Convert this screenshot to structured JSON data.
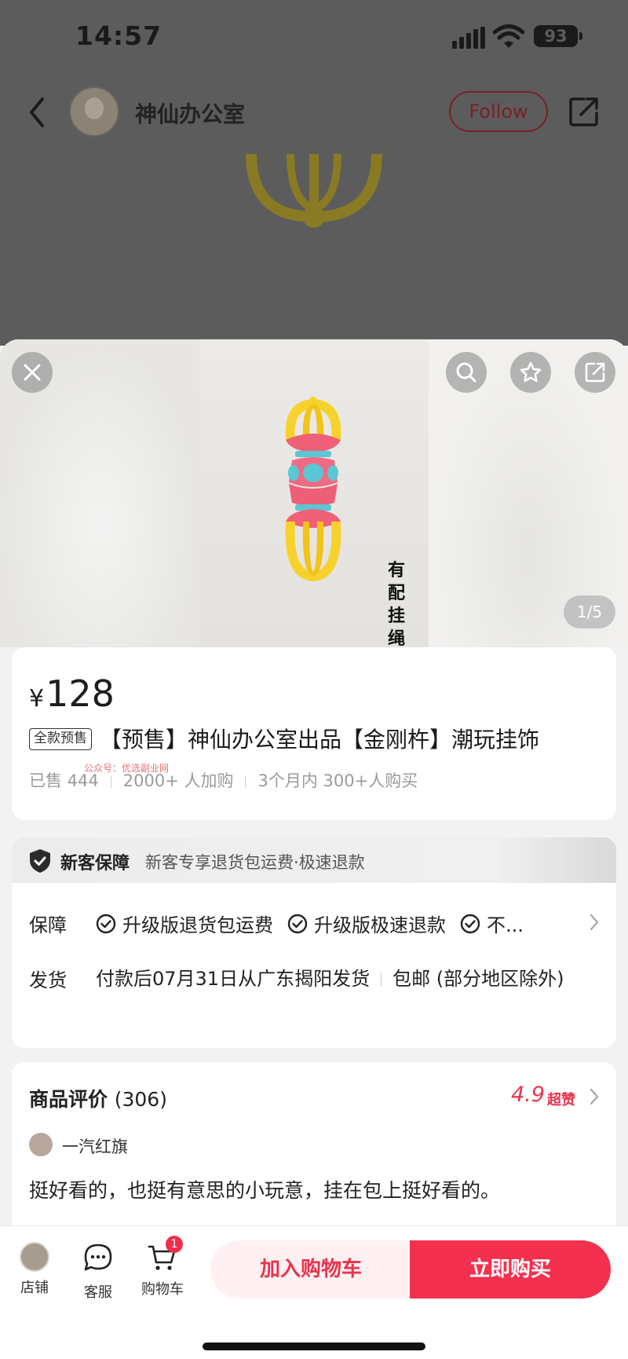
{
  "status_bar": {
    "time": "14:57",
    "battery": "93"
  },
  "shop_header": {
    "shop_name": "神仙办公室",
    "follow_label": "Follow"
  },
  "gallery": {
    "image_text": "有配挂绳",
    "counter": "1/5"
  },
  "product": {
    "currency": "¥",
    "price": "128",
    "presale_tag": "全款预售",
    "title": "【预售】神仙办公室出品【金刚杵】潮玩挂饰",
    "watermark": "公众号：优选副业网",
    "sold": "已售 444",
    "carted": "2000+ 人加购",
    "bought": "3个月内 300+人购买"
  },
  "guarantee_banner": {
    "title": "新客保障",
    "desc": "新客专享退货包运费·极速退款"
  },
  "service": {
    "guarantee_label": "保障",
    "guarantee_items": [
      "升级版退货包运费",
      "升级版极速退款",
      "不..."
    ],
    "shipping_label": "发货",
    "shipping_text": "付款后07月31日从广东揭阳发货",
    "shipping_free": "包邮 (部分地区除外)"
  },
  "reviews": {
    "title": "商品评价",
    "count": "(306)",
    "rating": "4.9",
    "rating_label": "超赞",
    "first_review": {
      "user": "一汽红旗",
      "text": "挺好看的，也挺有意思的小玩意，挂在包上挺好看的。"
    }
  },
  "bottom_bar": {
    "store_label": "店铺",
    "service_label": "客服",
    "cart_label": "购物车",
    "cart_badge": "1",
    "add_to_cart": "加入购物车",
    "buy_now": "立即购买"
  },
  "colors": {
    "accent": "#f4304f",
    "accent_light": "#fff1f2",
    "rating": "#e8334d"
  }
}
